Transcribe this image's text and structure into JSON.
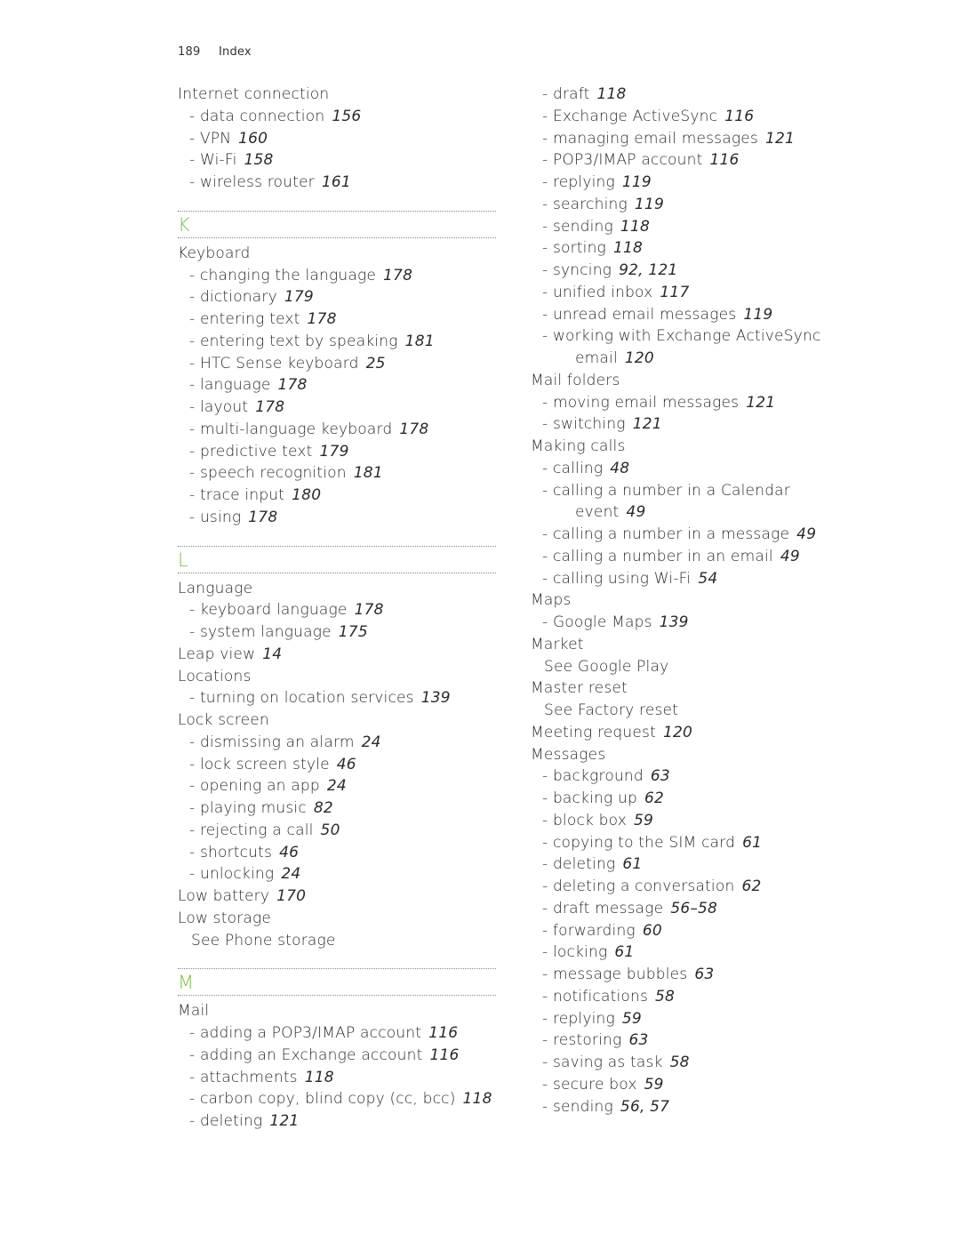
{
  "header": {
    "page_number": "189",
    "title": "Index"
  },
  "colors": {
    "section_letter": "#7dc242",
    "text": "#2b2b2b",
    "separator": "#8a8a8a"
  },
  "left_column": [
    {
      "type": "entry",
      "text": "Internet connection",
      "pages": ""
    },
    {
      "type": "sub",
      "text": "- data connection",
      "pages": "156"
    },
    {
      "type": "sub",
      "text": "- VPN",
      "pages": "160"
    },
    {
      "type": "sub",
      "text": "- Wi-Fi",
      "pages": "158"
    },
    {
      "type": "sub",
      "text": "- wireless router",
      "pages": "161"
    },
    {
      "type": "section",
      "text": "K"
    },
    {
      "type": "entry",
      "text": "Keyboard",
      "pages": ""
    },
    {
      "type": "sub",
      "text": "- changing the language",
      "pages": "178"
    },
    {
      "type": "sub",
      "text": "- dictionary",
      "pages": "179"
    },
    {
      "type": "sub",
      "text": "- entering text",
      "pages": "178"
    },
    {
      "type": "sub",
      "text": "- entering text by speaking",
      "pages": "181"
    },
    {
      "type": "sub",
      "text": "- HTC Sense keyboard",
      "pages": "25"
    },
    {
      "type": "sub",
      "text": "- language",
      "pages": "178"
    },
    {
      "type": "sub",
      "text": "- layout",
      "pages": "178"
    },
    {
      "type": "sub",
      "text": "- multi-language keyboard",
      "pages": "178"
    },
    {
      "type": "sub",
      "text": "- predictive text",
      "pages": "179"
    },
    {
      "type": "sub",
      "text": "- speech recognition",
      "pages": "181"
    },
    {
      "type": "sub",
      "text": "- trace input",
      "pages": "180"
    },
    {
      "type": "sub",
      "text": "- using",
      "pages": "178"
    },
    {
      "type": "section",
      "text": "L"
    },
    {
      "type": "entry",
      "text": "Language",
      "pages": ""
    },
    {
      "type": "sub",
      "text": "- keyboard language",
      "pages": "178"
    },
    {
      "type": "sub",
      "text": "- system language",
      "pages": "175"
    },
    {
      "type": "entry",
      "text": "Leap view",
      "pages": "14"
    },
    {
      "type": "entry",
      "text": "Locations",
      "pages": ""
    },
    {
      "type": "sub",
      "text": "- turning on location services",
      "pages": "139"
    },
    {
      "type": "entry",
      "text": "Lock screen",
      "pages": ""
    },
    {
      "type": "sub",
      "text": "- dismissing an alarm",
      "pages": "24"
    },
    {
      "type": "sub",
      "text": "- lock screen style",
      "pages": "46"
    },
    {
      "type": "sub",
      "text": "- opening an app",
      "pages": "24"
    },
    {
      "type": "sub",
      "text": "- playing music",
      "pages": "82"
    },
    {
      "type": "sub",
      "text": "- rejecting a call",
      "pages": "50"
    },
    {
      "type": "sub",
      "text": "- shortcuts",
      "pages": "46"
    },
    {
      "type": "sub",
      "text": "- unlocking",
      "pages": "24"
    },
    {
      "type": "entry",
      "text": "Low battery",
      "pages": "170"
    },
    {
      "type": "entry",
      "text": "Low storage",
      "pages": ""
    },
    {
      "type": "see",
      "text": "See Phone storage",
      "pages": ""
    },
    {
      "type": "section",
      "text": "M"
    },
    {
      "type": "entry",
      "text": "Mail",
      "pages": ""
    },
    {
      "type": "sub",
      "text": "- adding a POP3/IMAP account",
      "pages": "116"
    },
    {
      "type": "sub",
      "text": "- adding an Exchange account",
      "pages": "116"
    },
    {
      "type": "sub",
      "text": "- attachments",
      "pages": "118"
    },
    {
      "type": "sub",
      "text": "- carbon copy, blind copy (cc, bcc)",
      "pages": "118"
    },
    {
      "type": "sub",
      "text": "- deleting",
      "pages": "121"
    }
  ],
  "right_column": [
    {
      "type": "sub",
      "text": "- draft",
      "pages": "118"
    },
    {
      "type": "sub",
      "text": "- Exchange ActiveSync",
      "pages": "116"
    },
    {
      "type": "sub",
      "text": "- managing email messages",
      "pages": "121"
    },
    {
      "type": "sub",
      "text": "- POP3/IMAP account",
      "pages": "116"
    },
    {
      "type": "sub",
      "text": "- replying",
      "pages": "119"
    },
    {
      "type": "sub",
      "text": "- searching",
      "pages": "119"
    },
    {
      "type": "sub",
      "text": "- sending",
      "pages": "118"
    },
    {
      "type": "sub",
      "text": "- sorting",
      "pages": "118"
    },
    {
      "type": "sub",
      "text": "- syncing",
      "pages": "92, 121"
    },
    {
      "type": "sub",
      "text": "- unified inbox",
      "pages": "117"
    },
    {
      "type": "sub",
      "text": "- unread email messages",
      "pages": "119"
    },
    {
      "type": "sub",
      "text": "- working with Exchange ActiveSync",
      "pages": ""
    },
    {
      "type": "cont",
      "text": "email",
      "pages": "120"
    },
    {
      "type": "entry",
      "text": "Mail folders",
      "pages": ""
    },
    {
      "type": "sub",
      "text": "- moving email messages",
      "pages": "121"
    },
    {
      "type": "sub",
      "text": "- switching",
      "pages": "121"
    },
    {
      "type": "entry",
      "text": "Making calls",
      "pages": ""
    },
    {
      "type": "sub",
      "text": "- calling",
      "pages": "48"
    },
    {
      "type": "sub",
      "text": "- calling a number in a Calendar",
      "pages": ""
    },
    {
      "type": "cont",
      "text": "event",
      "pages": "49"
    },
    {
      "type": "sub",
      "text": "- calling a number in a message",
      "pages": "49"
    },
    {
      "type": "sub",
      "text": "- calling a number in an email",
      "pages": "49"
    },
    {
      "type": "sub",
      "text": "- calling using Wi-Fi",
      "pages": "54"
    },
    {
      "type": "entry",
      "text": "Maps",
      "pages": ""
    },
    {
      "type": "sub",
      "text": "- Google Maps",
      "pages": "139"
    },
    {
      "type": "entry",
      "text": "Market",
      "pages": ""
    },
    {
      "type": "see",
      "text": "See Google Play",
      "pages": ""
    },
    {
      "type": "entry",
      "text": "Master reset",
      "pages": ""
    },
    {
      "type": "see",
      "text": "See Factory reset",
      "pages": ""
    },
    {
      "type": "entry",
      "text": "Meeting request",
      "pages": "120"
    },
    {
      "type": "entry",
      "text": "Messages",
      "pages": ""
    },
    {
      "type": "sub",
      "text": "- background",
      "pages": "63"
    },
    {
      "type": "sub",
      "text": "- backing up",
      "pages": "62"
    },
    {
      "type": "sub",
      "text": "- block box",
      "pages": "59"
    },
    {
      "type": "sub",
      "text": "- copying to the SIM card",
      "pages": "61"
    },
    {
      "type": "sub",
      "text": "- deleting",
      "pages": "61"
    },
    {
      "type": "sub",
      "text": "- deleting a conversation",
      "pages": "62"
    },
    {
      "type": "sub",
      "text": "- draft message",
      "pages": "56–58"
    },
    {
      "type": "sub",
      "text": "- forwarding",
      "pages": "60"
    },
    {
      "type": "sub",
      "text": "- locking",
      "pages": "61"
    },
    {
      "type": "sub",
      "text": "- message bubbles",
      "pages": "63"
    },
    {
      "type": "sub",
      "text": "- notifications",
      "pages": "58"
    },
    {
      "type": "sub",
      "text": "- replying",
      "pages": "59"
    },
    {
      "type": "sub",
      "text": "- restoring",
      "pages": "63"
    },
    {
      "type": "sub",
      "text": "- saving as task",
      "pages": "58"
    },
    {
      "type": "sub",
      "text": "- secure box",
      "pages": "59"
    },
    {
      "type": "sub",
      "text": "- sending",
      "pages": "56, 57"
    }
  ]
}
